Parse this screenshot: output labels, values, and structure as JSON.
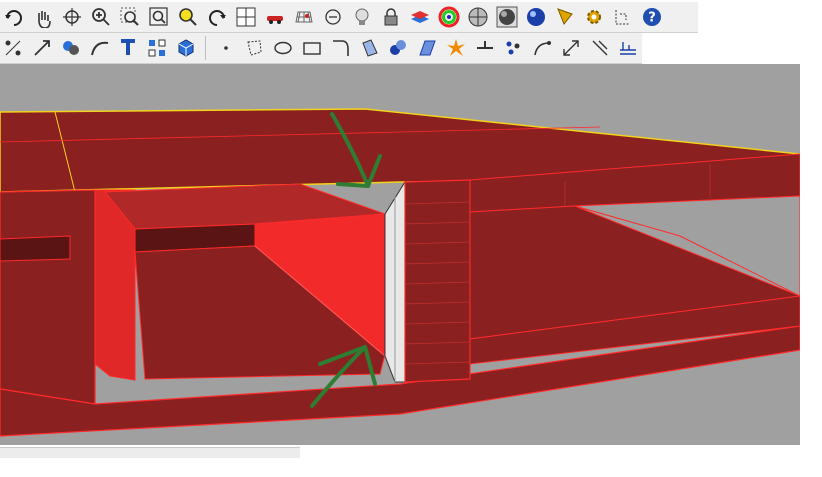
{
  "toolbars": {
    "row1": [
      "rotate-arrow-icon",
      "pan-hand-icon",
      "rotate-view-icon",
      "zoom-in-icon",
      "zoom-window-icon",
      "zoom-extents-icon",
      "zoom-selected-icon",
      "undo-view-icon",
      "four-viewports-icon",
      "car-object-icon",
      "grid-icon",
      "circle-point-icon",
      "light-bulb-icon",
      "lock-icon",
      "layers-icon",
      "color-wheel-icon",
      "sphere-shaded-icon",
      "sphere-render-icon",
      "sphere-blue-icon",
      "flag-icon",
      "gear-icon",
      "dimension-icon",
      "help-icon"
    ],
    "row2": [
      "snap-points-icon",
      "transform-icon",
      "boolean-icon",
      "curve-icon",
      "text-t-icon",
      "array-icon",
      "cube-icon",
      "point-icon",
      "polygon-icon",
      "ellipse-icon",
      "rectangle-icon",
      "arc-icon",
      "surface-icon",
      "spheres-icon",
      "plane-surface-icon",
      "explode-icon",
      "extend-icon",
      "group-points-icon",
      "rotate-curve-icon",
      "scale-icon",
      "mirror-icon",
      "dimension-ruler-icon"
    ]
  },
  "viewport": {
    "name": "perspective-viewport",
    "colors": {
      "background": "#a0a0a0",
      "surface_dark": "#8a2020",
      "surface_mid": "#b12828",
      "surface_bright": "#e02828",
      "edge": "#ff2a2a",
      "highlight_edge": "#f2d21c",
      "seam": "#e8e8e8",
      "arrow": "#2e7d32"
    }
  },
  "help_label": "?"
}
